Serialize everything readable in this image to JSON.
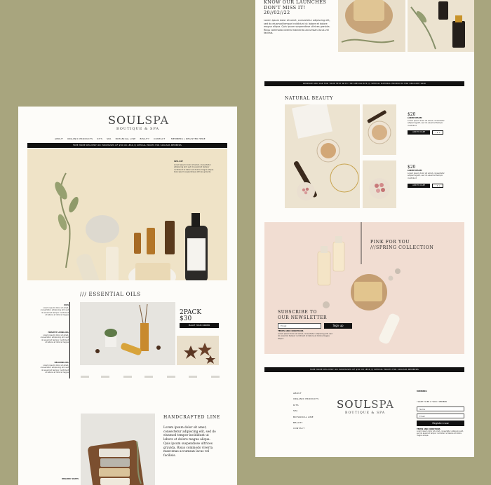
{
  "left": {
    "logo_main": "SOUL",
    "logo_sub": "SPA",
    "tagline": "BOUTIQUE & SPA",
    "nav": [
      "ABOUT",
      "ORGANIC PRODUCTS",
      "KITS",
      "SPA",
      "BOTANICAL LINE",
      "BEAUTY",
      "CONTACT"
    ],
    "nav_right": "MEMBERS | REGISTER HERE",
    "promo_bar": "FREE HOME DELIVERY ON PURCHASES OF $50 OR LESS /// SPECIAL PRICES FOR SOULSPA MEMBERS",
    "hero_kit_title": "SPA KIT",
    "hero_kit_text": "Lorem ipsum dolor sit amet, consectetur adipiscing elit, sed do eiusmod tempor incididunt ut labore et dolore magna aliqua. Quis ipsum suspendisse ultrices gravida.",
    "essential_heading": "/// ESSENTIAL OILS",
    "side_items": [
      {
        "title": "OILS",
        "text": "Lorem ipsum dolor sit amet, consectetur adipiscing elit, sed do eiusmod tempor incididunt ut labore et dolore magna"
      },
      {
        "title": "HEALTHY LIVING OIL",
        "text": "Lorem ipsum dolor sit amet, consectetur adipiscing elit, sed do eiusmod tempor incididunt ut labore et dolore magna"
      },
      {
        "title": "RELAXING OIL",
        "text": "Lorem ipsum dolor sit amet, consectetur adipiscing elit, sed do eiusmod tempor incididunt ut labore et dolore magna"
      }
    ],
    "pack_title": "2PACK",
    "pack_price": "$30",
    "place_order": "PLACE YOUR ORDER",
    "handcrafted_heading": "HANDCRAFTED LINE",
    "handcrafted_text": "Lorem ipsum dolor sit amet, consectetur adipiscing elit, sed do eiusmod tempor incididunt ut labore et dolore magna aliqua. Quis ipsum suspendisse ultrices gravida. Risus commodo viverra maecenas accumsan lacus vel facilisis.",
    "organic_soap": "ORGANIC SOAPS"
  },
  "right": {
    "launch_heading_1": "KNOW OUR LAUNCHES",
    "launch_heading_2": "DON'T MISS IT!",
    "launch_date": "20//02//22",
    "launch_text": "Lorem ipsum dolor sit amet, consectetur adipiscing elit, sed do eiusmod tempor incididunt ut labore et dolore magna aliqua. Quis ipsum suspendisse ultrices gravida. Risus commodo viverra maecenas accumsan lacus vel facilisis.",
    "specialists_bar": "RESERVE AND ASK FOR YOUR TEST WITH THE SPECIALISTS /// SPECIAL NATURAL PRODUCTS FOR DELICATE SKIN",
    "natural_heading": "NATURAL BEAUTY",
    "products": [
      {
        "price": "$20",
        "name": "LOREM IPSUM",
        "desc": "Lorem ipsum dolor sit amet, consectetur adipiscing elit, sed do eiusmod tempor incididunt",
        "add": "ADD TO CART",
        "qty": "1"
      },
      {
        "price": "$20",
        "name": "LOREM IPSUM",
        "desc": "Lorem ipsum dolor sit amet, consectetur adipiscing elit, sed do eiusmod tempor incididunt",
        "add": "ADD TO CART",
        "qty": "1"
      }
    ],
    "pink_1": "PINK FOR YOU",
    "pink_2": "///SPRING COLLECTION",
    "subscribe_1": "SUBSCRIBE TO",
    "subscribe_2": "OUR NEWSLETTER",
    "email_placeholder": "Email",
    "signup": "Sign up",
    "terms_title": "TERMS AND CONDITIONS",
    "terms_text": "Lorem ipsum dolor sit amet, consectetur adipiscing elit, sed do eiusmod tempor incididunt ut labore et dolore magna aliqua.",
    "footer_bar": "FREE HOME DELIVERY ON PURCHASES OF $50 OR LESS /// SPECIAL PRICES FOR SOULSPA MEMBERS",
    "footer_nav": [
      "ABOUT",
      "ORGANIC PRODUCTS",
      "KITS",
      "SPA",
      "BOTANICAL LINE",
      "BEAUTY",
      "CONTACT"
    ],
    "logo_main": "SOUL",
    "logo_sub": "SPA",
    "tagline": "BOUTIQUE & SPA",
    "members_title": "MEMBERS",
    "members_sub": "I WANT TO BE A \"SOUL\" MEMBER",
    "name_placeholder": "Name",
    "email_placeholder_2": "Email",
    "register": "Register now",
    "footer_terms_title": "TERMS AND CONDITIONS",
    "footer_terms_text": "Lorem ipsum dolor sit amet, consectetur adipiscing elit, sed do eiusmod tempor incididunt ut labore et dolore magna aliqua."
  }
}
